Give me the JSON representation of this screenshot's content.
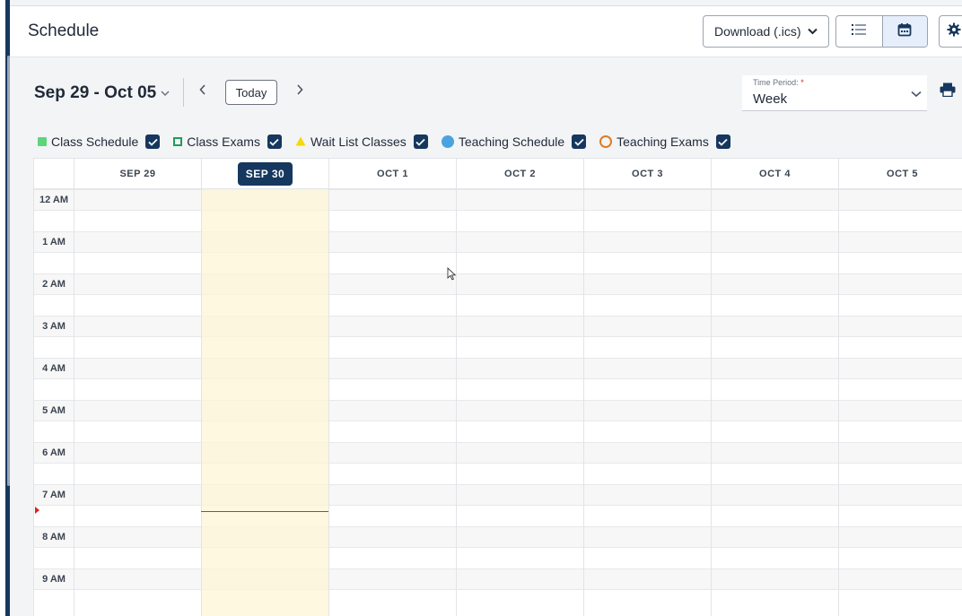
{
  "header": {
    "title": "Schedule",
    "download_label": "Download (.ics)"
  },
  "toolbar": {
    "date_range": "Sep 29 - Oct 05",
    "today_label": "Today",
    "time_period": {
      "label": "Time Period:",
      "required_mark": "*",
      "value": "Week"
    }
  },
  "legend": [
    {
      "label": "Class Schedule",
      "symbol": "filled-square",
      "color": "#5cd679",
      "checked": true
    },
    {
      "label": "Class Exams",
      "symbol": "outline-square",
      "color": "#1f9d55",
      "checked": true
    },
    {
      "label": "Wait List Classes",
      "symbol": "triangle",
      "color": "#f5d90a",
      "checked": true
    },
    {
      "label": "Teaching Schedule",
      "symbol": "filled-circle",
      "color": "#4aa3df",
      "checked": true
    },
    {
      "label": "Teaching Exams",
      "symbol": "outline-circle",
      "color": "#e07b24",
      "checked": true
    }
  ],
  "calendar": {
    "days": [
      "SEP 29",
      "SEP 30",
      "OCT 1",
      "OCT 2",
      "OCT 3",
      "OCT 4",
      "OCT 5"
    ],
    "today_index": 1,
    "hours": [
      "12 AM",
      "1 AM",
      "2 AM",
      "3 AM",
      "4 AM",
      "5 AM",
      "6 AM",
      "7 AM",
      "8 AM",
      "9 AM"
    ]
  },
  "colors": {
    "accent": "#16375e",
    "today_highlight": "#fef6d6",
    "now_line": "#c0392b"
  }
}
